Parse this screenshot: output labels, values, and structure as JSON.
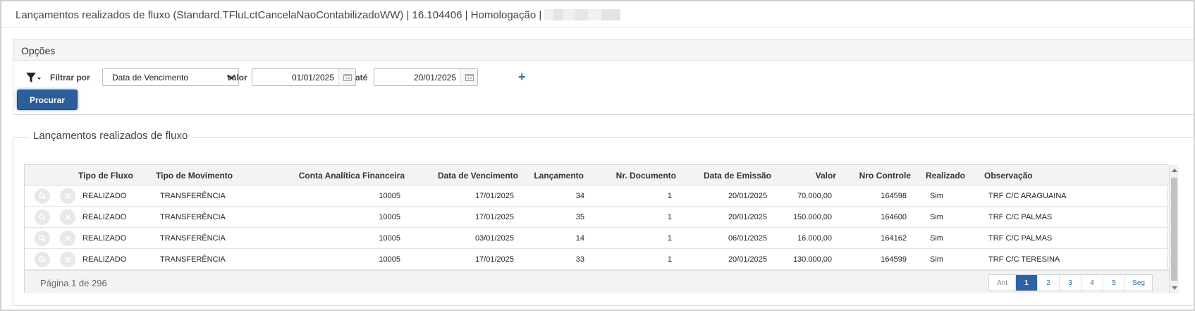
{
  "window": {
    "title": "Lançamentos realizados de fluxo (Standard.TFluLctCancelaNaoContabilizadoWW) | 16.104406 | Homologação |"
  },
  "options": {
    "header": "Opções",
    "filter_label": "Filtrar por",
    "filter_selected": "Data de Vencimento",
    "value_label": "valor",
    "date_from": "01/01/2025",
    "until_label": "até",
    "date_to": "20/01/2025",
    "add_symbol": "+",
    "search_button": "Procurar"
  },
  "results": {
    "legend": "Lançamentos realizados de fluxo",
    "columns": [
      "Tipo de Fluxo",
      "Tipo de Movimento",
      "Conta Analítica Financeira",
      "Data de Vencimento",
      "Lançamento",
      "Nr. Documento",
      "Data de Emissão",
      "Valor",
      "Nro Controle",
      "Realizado",
      "Observação"
    ],
    "rows": [
      [
        "REALIZADO",
        "TRANSFERÊNCIA",
        "10005",
        "17/01/2025",
        "34",
        "1",
        "20/01/2025",
        "70.000,00",
        "164598",
        "Sim",
        "TRF C/C ARAGUAINA"
      ],
      [
        "REALIZADO",
        "TRANSFERÊNCIA",
        "10005",
        "17/01/2025",
        "35",
        "1",
        "20/01/2025",
        "150.000,00",
        "164600",
        "Sim",
        "TRF C/C PALMAS"
      ],
      [
        "REALIZADO",
        "TRANSFERÊNCIA",
        "10005",
        "03/01/2025",
        "14",
        "1",
        "06/01/2025",
        "16.000,00",
        "164162",
        "Sim",
        "TRF C/C PALMAS"
      ],
      [
        "REALIZADO",
        "TRANSFERÊNCIA",
        "10005",
        "17/01/2025",
        "33",
        "1",
        "20/01/2025",
        "130.000,00",
        "164599",
        "Sim",
        "TRF C/C TERESINA"
      ]
    ],
    "page_info": "Página 1 de 296",
    "pager": {
      "prev": "Ant",
      "pages": [
        "1",
        "2",
        "3",
        "4",
        "5"
      ],
      "active_page": "1",
      "next": "Seg"
    }
  },
  "colors": {
    "primary_button": "#2c5f9a",
    "active_page": "#2d63a4",
    "link": "#2a6db0"
  }
}
